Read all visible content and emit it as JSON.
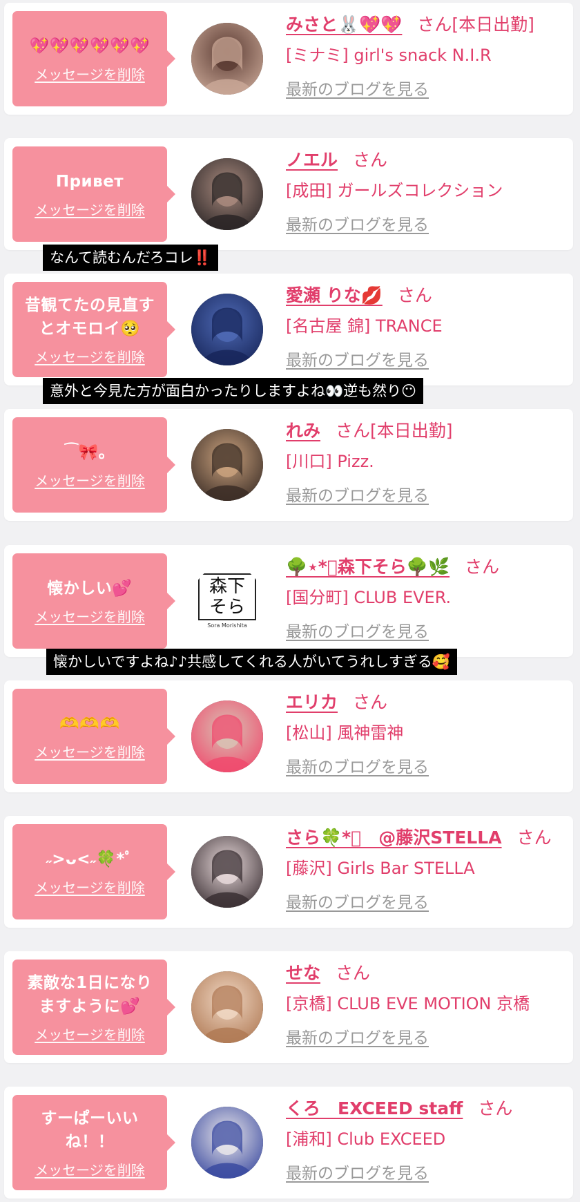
{
  "messages": [
    {
      "text": "💖💖💖💖💖💖",
      "delete_label": "メッセージを削除",
      "name": "みさと🐰💖💖",
      "suffix": "さん[本日出勤]",
      "shop": "[ミナミ] girl's snack N.I.R",
      "blog_label": "最新のブログを見る",
      "avatar_colors": [
        "#c9a796",
        "#5b3b33"
      ]
    },
    {
      "text": "Привет",
      "delete_label": "メッセージを削除",
      "name": "ノエル",
      "suffix": "さん",
      "shop": "[成田] ガールズコレクション",
      "blog_label": "最新のブログを見る",
      "avatar_colors": [
        "#2a2526",
        "#a98a7e"
      ]
    },
    {
      "text": "昔観てたの見直すとオモロイ🥺",
      "delete_label": "メッセージを削除",
      "name": "愛瀬 りな💋",
      "suffix": "さん",
      "shop": "[名古屋 錦] TRANCE",
      "blog_label": "最新のブログを見る",
      "avatar_colors": [
        "#17265a",
        "#4f6ab5"
      ]
    },
    {
      "text": "⁀🎀。",
      "delete_label": "メッセージを削除",
      "name": "れみ",
      "suffix": "さん[本日出勤]",
      "shop": "[川口] Pizz.",
      "blog_label": "最新のブログを見る",
      "avatar_colors": [
        "#3b2d26",
        "#caa27e"
      ]
    },
    {
      "text": "懐かしい💕",
      "delete_label": "メッセージを削除",
      "name": "🌳⋆*ﾟ森下そら🌳🌿",
      "suffix": "さん",
      "shop": "[国分町] CLUB EVER.",
      "blog_label": "最新のブログを見る",
      "logo_text": "森下そら",
      "logo_caption": "Sora Morishita"
    },
    {
      "text": "🫶🫶🫶",
      "delete_label": "メッセージを削除",
      "name": "エリカ",
      "suffix": "さん",
      "shop": "[松山] 風神雷神",
      "blog_label": "最新のブログを見る",
      "avatar_colors": [
        "#f04a6d",
        "#d8c2b4"
      ]
    },
    {
      "text": "˶>ᴗ<˶🍀*ﾟ",
      "delete_label": "メッセージを削除",
      "name": "さら🍀*ﾟ　@藤沢STELLA",
      "suffix": "さん",
      "shop": "[藤沢] Girls Bar STELLA",
      "blog_label": "最新のブログを見る",
      "avatar_colors": [
        "#3a2f33",
        "#e8d9da"
      ]
    },
    {
      "text": "素敵な1日になりますように💕",
      "delete_label": "メッセージを削除",
      "name": "せな",
      "suffix": "さん",
      "shop": "[京橋] CLUB EVE MOTION 京橋",
      "blog_label": "最新のブログを見る",
      "avatar_colors": [
        "#b07a55",
        "#f0d7c3"
      ]
    },
    {
      "text": "すーぱーいいね！！",
      "delete_label": "メッセージを削除",
      "name": "くろ　EXCEED staff",
      "suffix": "さん",
      "shop": "[浦和] Club EXCEED",
      "blog_label": "最新のブログを見る",
      "avatar_colors": [
        "#3a4aa0",
        "#e9e6ea"
      ]
    }
  ],
  "captions": [
    {
      "text": "なんて読むんだろコレ",
      "mark": "‼️"
    },
    {
      "text": "意外と今見た方が面白かったりしますよね👀逆も然り",
      "mark": "😶"
    },
    {
      "text": "懐かしいですよね♪♪共感してくれる人がいてうれしすぎる",
      "mark": "🥰"
    }
  ]
}
